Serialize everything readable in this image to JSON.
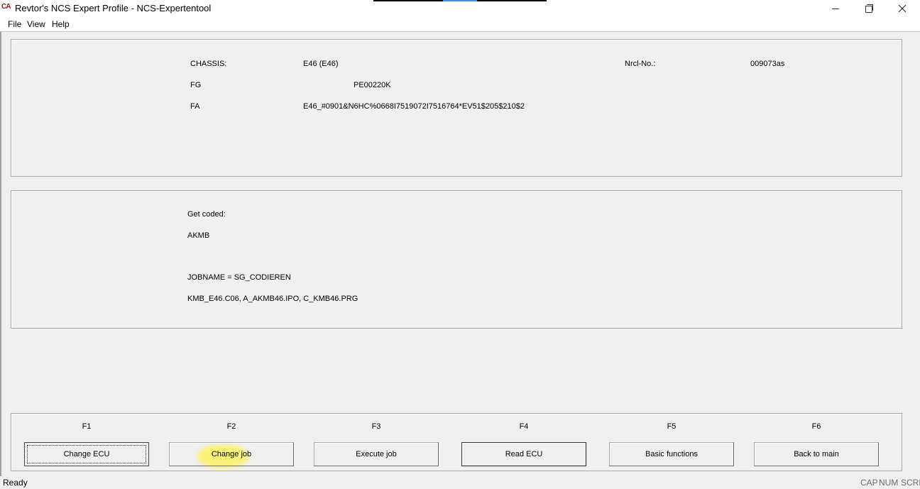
{
  "window": {
    "title": "Revtor's NCS Expert Profile - NCS-Expertentool",
    "icon_text": "CA"
  },
  "menu": [
    "File",
    "View",
    "Help"
  ],
  "info": {
    "chassis_label": "CHASSIS:",
    "chassis_value": "E46 (E46)",
    "nrcl_label": "Nrcl-No.:",
    "nrcl_value": "009073as",
    "fg_label": "FG",
    "fg_value": "PE00220K",
    "fa_label": "FA",
    "fa_value": "E46_#0901&N6HC%0668I7519072I7516764*EV51$205$210$2"
  },
  "job": {
    "line1": "Get coded:",
    "line2": "AKMB",
    "line3": "JOBNAME = SG_CODIEREN",
    "line4": "KMB_E46.C06, A_AKMB46.IPO, C_KMB46.PRG"
  },
  "function_keys": [
    {
      "key": "F1",
      "label": "Change ECU"
    },
    {
      "key": "F2",
      "label": "Change job"
    },
    {
      "key": "F3",
      "label": "Execute job"
    },
    {
      "key": "F4",
      "label": "Read ECU"
    },
    {
      "key": "F5",
      "label": "Basic functions"
    },
    {
      "key": "F6",
      "label": "Back to main"
    }
  ],
  "status": {
    "text": "Ready",
    "indicators": [
      "CAP",
      "NUM",
      "SCRL"
    ]
  },
  "colors": {
    "highlight": "#fff450"
  }
}
